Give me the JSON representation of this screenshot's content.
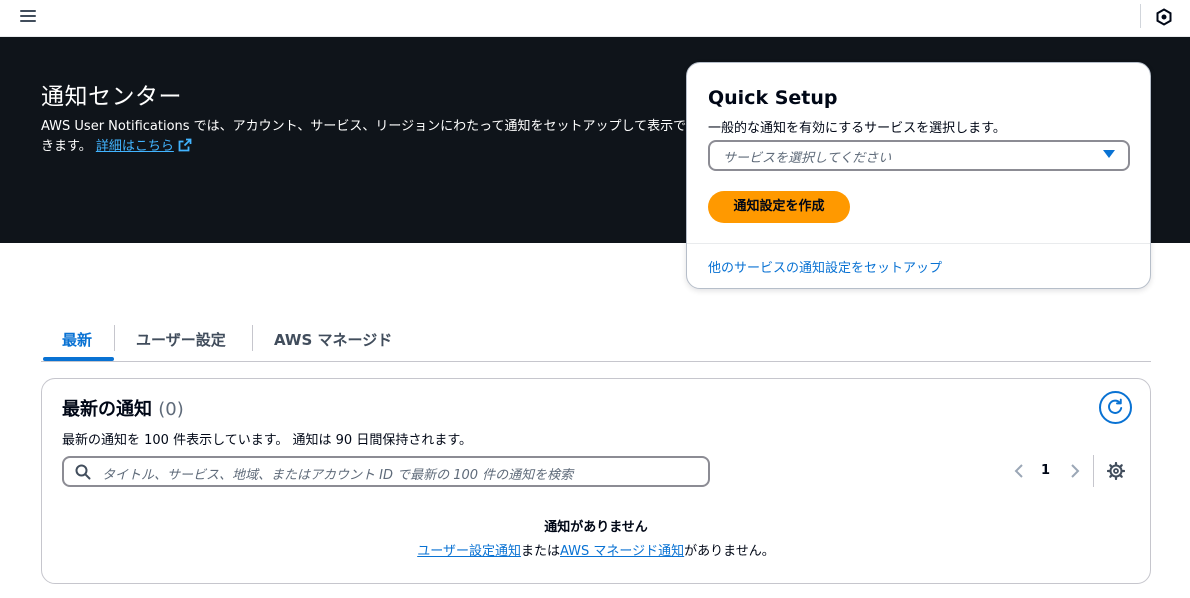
{
  "topbar": {
    "menu_icon": "hamburger-menu-icon",
    "right_icon": "hexagon-icon"
  },
  "hero": {
    "title": "通知センター",
    "description": "AWS User Notifications では、アカウント、サービス、リージョンにわたって通知をセットアップして表示できます。",
    "link_label": "詳細はこちら",
    "link_icon": "external-link-icon"
  },
  "quick_setup": {
    "title": "Quick Setup",
    "subtitle": "一般的な通知を有効にするサービスを選択します。",
    "select_placeholder": "サービスを選択してください",
    "create_button": "通知設定を作成",
    "footer_link": "他のサービスの通知設定をセットアップ"
  },
  "tabs": [
    {
      "label": "最新",
      "active": true
    },
    {
      "label": "ユーザー設定",
      "active": false
    },
    {
      "label": "AWS マネージド",
      "active": false
    }
  ],
  "panel": {
    "title": "最新の通知",
    "count": "(0)",
    "description": "最新の通知を 100 件表示しています。 通知は 90 日間保持されます。",
    "search_placeholder": "タイトル、サービス、地域、またはアカウント ID で最新の 100 件の通知を検索",
    "page_number": "1",
    "empty_title": "通知がありません",
    "empty_link_user": "ユーザー設定通知",
    "empty_or": "または",
    "empty_link_aws": "AWS マネージド通知",
    "empty_suffix": "がありません。"
  },
  "colors": {
    "hero_bg": "#0f141a",
    "primary_button": "#ff9900",
    "link": "#0972d3",
    "hero_link": "#42b4ff"
  }
}
